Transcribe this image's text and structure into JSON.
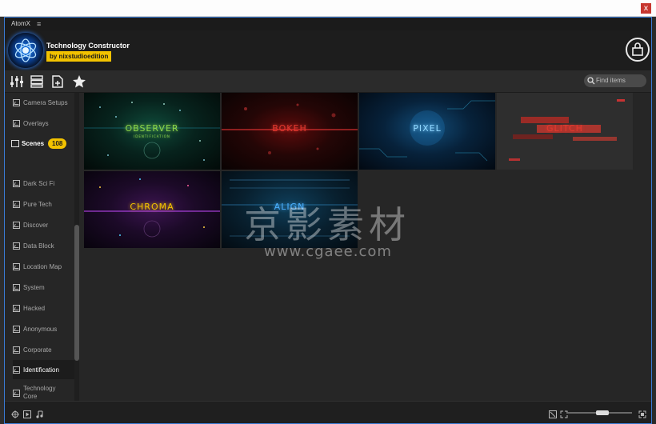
{
  "window": {
    "title": "AtomX",
    "close_label": "x"
  },
  "header": {
    "title": "Technology Constructor",
    "author": "by nixstudioedition"
  },
  "search": {
    "placeholder": "Find items"
  },
  "sidebar": {
    "items_top": [
      "Camera Setups",
      "Overlays"
    ],
    "scenes": {
      "label": "Scenes",
      "count": "108"
    },
    "items": [
      "Dark Sci Fi",
      "Pure Tech",
      "Discover",
      "Data Block",
      "Location Map",
      "System",
      "Hacked",
      "Anonymous",
      "Corporate",
      "Identification",
      "Technology Core"
    ],
    "active": "Identification"
  },
  "thumbnails": [
    {
      "title": "OBSERVER",
      "subtitle": "IDENTIFICATION",
      "color": "#8bd44a"
    },
    {
      "title": "BOKEH",
      "subtitle": "",
      "color": "#e2392f"
    },
    {
      "title": "PIXEL",
      "subtitle": "",
      "color": "#8fd6ff"
    },
    {
      "title": "GLITCH",
      "subtitle": "",
      "color": "#e2392f"
    },
    {
      "title": "CHROMA",
      "subtitle": "",
      "color": "#f2c200"
    },
    {
      "title": "ALIGN",
      "subtitle": "",
      "color": "#4bb0ff"
    }
  ],
  "watermark": {
    "text": "京影素材",
    "url": "www.cgaee.com"
  },
  "colors": {
    "accent": "#f2c200",
    "frame": "#3a7bd5",
    "bg": "#262626"
  },
  "icons": [
    "sliders-icon",
    "list-icon",
    "file-plus-icon",
    "star-icon",
    "search-icon",
    "shopping-bag-icon",
    "target-icon",
    "play-icon",
    "music-icon",
    "fit-icon",
    "expand-icon",
    "fullscreen-icon"
  ],
  "zoom": {
    "value": 0.55
  }
}
